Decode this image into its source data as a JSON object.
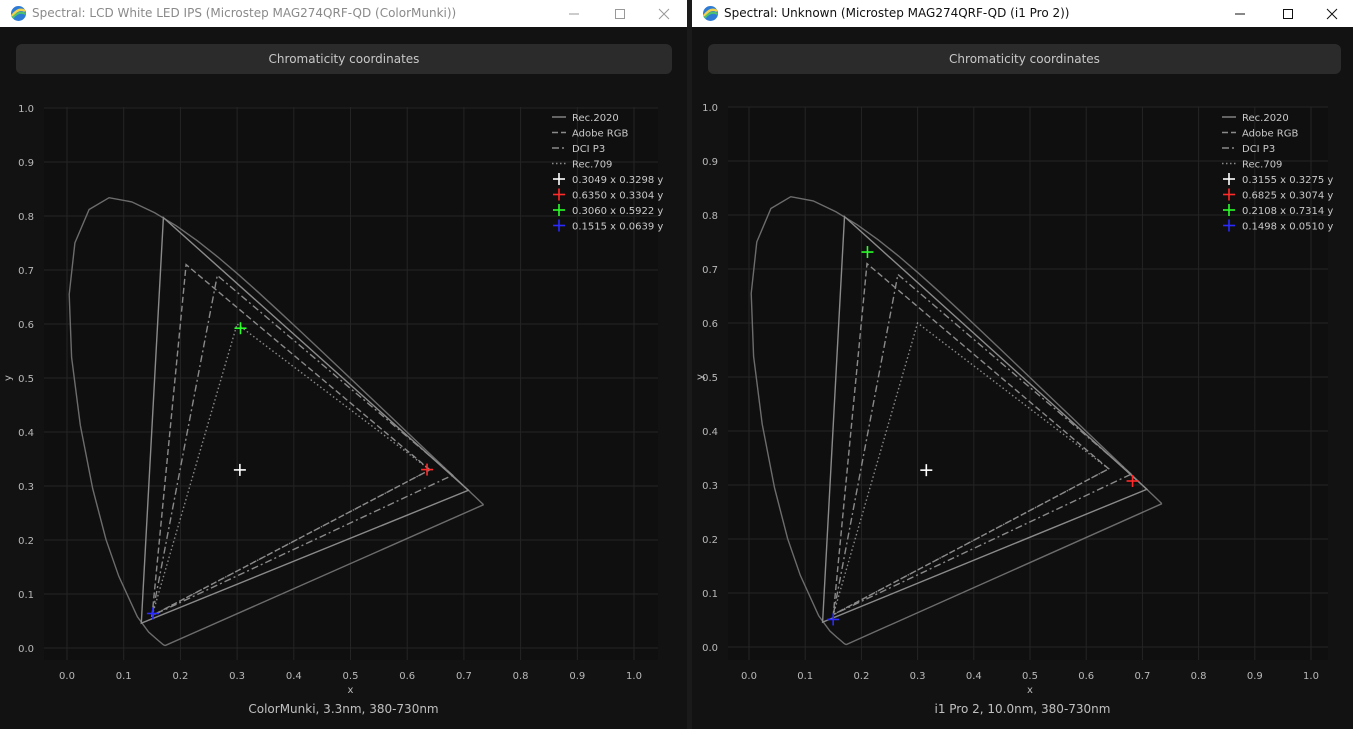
{
  "windows": [
    {
      "title": "Spectral: LCD White LED IPS (Microstep MAG274QRF-QD (ColorMunki))",
      "active": false,
      "header_button": "Chromaticity coordinates",
      "footer": "ColorMunki, 3.3nm, 380-730nm",
      "chart_data": {
        "type": "scatter",
        "xlabel": "x",
        "ylabel": "y",
        "xlim": [
          0.0,
          1.0
        ],
        "ylim": [
          0.0,
          1.0
        ],
        "x_ticks": [
          "0.0",
          "0.1",
          "0.2",
          "0.3",
          "0.4",
          "0.5",
          "0.6",
          "0.7",
          "0.8",
          "0.9",
          "1.0"
        ],
        "y_ticks": [
          "0.0",
          "0.1",
          "0.2",
          "0.3",
          "0.4",
          "0.5",
          "0.6",
          "0.7",
          "0.8",
          "0.9",
          "1.0"
        ],
        "grid": true,
        "legend_position": "top-right",
        "gamuts": [
          {
            "name": "Rec.2020",
            "style": "solid",
            "points": [
              [
                0.708,
                0.292
              ],
              [
                0.17,
                0.797
              ],
              [
                0.131,
                0.046
              ]
            ]
          },
          {
            "name": "Adobe RGB",
            "style": "dashed",
            "points": [
              [
                0.64,
                0.33
              ],
              [
                0.21,
                0.71
              ],
              [
                0.15,
                0.06
              ]
            ]
          },
          {
            "name": "DCI P3",
            "style": "dashdot",
            "points": [
              [
                0.68,
                0.32
              ],
              [
                0.265,
                0.69
              ],
              [
                0.15,
                0.06
              ]
            ]
          },
          {
            "name": "Rec.709",
            "style": "dotted",
            "points": [
              [
                0.64,
                0.33
              ],
              [
                0.3,
                0.6
              ],
              [
                0.15,
                0.06
              ]
            ]
          }
        ],
        "measurements": [
          {
            "label": "0.3049 x  0.3298 y",
            "x": 0.3049,
            "y": 0.3298,
            "color": "#ffffff"
          },
          {
            "label": "0.6350 x  0.3304 y",
            "x": 0.635,
            "y": 0.3304,
            "color": "#ff2a2a"
          },
          {
            "label": "0.3060 x  0.5922 y",
            "x": 0.306,
            "y": 0.5922,
            "color": "#2aff2a"
          },
          {
            "label": "0.1515 x  0.0639 y",
            "x": 0.1515,
            "y": 0.0639,
            "color": "#2a2aff"
          }
        ]
      }
    },
    {
      "title": "Spectral: Unknown (Microstep MAG274QRF-QD (i1 Pro 2))",
      "active": true,
      "header_button": "Chromaticity coordinates",
      "footer": "i1 Pro 2, 10.0nm, 380-730nm",
      "chart_data": {
        "type": "scatter",
        "xlabel": "x",
        "ylabel": "y",
        "xlim": [
          0.0,
          1.0
        ],
        "ylim": [
          0.0,
          1.0
        ],
        "x_ticks": [
          "0.0",
          "0.1",
          "0.2",
          "0.3",
          "0.4",
          "0.5",
          "0.6",
          "0.7",
          "0.8",
          "0.9",
          "1.0"
        ],
        "y_ticks": [
          "0.0",
          "0.1",
          "0.2",
          "0.3",
          "0.4",
          "0.5",
          "0.6",
          "0.7",
          "0.8",
          "0.9",
          "1.0"
        ],
        "grid": true,
        "legend_position": "top-right",
        "gamuts": [
          {
            "name": "Rec.2020",
            "style": "solid",
            "points": [
              [
                0.708,
                0.292
              ],
              [
                0.17,
                0.797
              ],
              [
                0.131,
                0.046
              ]
            ]
          },
          {
            "name": "Adobe RGB",
            "style": "dashed",
            "points": [
              [
                0.64,
                0.33
              ],
              [
                0.21,
                0.71
              ],
              [
                0.15,
                0.06
              ]
            ]
          },
          {
            "name": "DCI P3",
            "style": "dashdot",
            "points": [
              [
                0.68,
                0.32
              ],
              [
                0.265,
                0.69
              ],
              [
                0.15,
                0.06
              ]
            ]
          },
          {
            "name": "Rec.709",
            "style": "dotted",
            "points": [
              [
                0.64,
                0.33
              ],
              [
                0.3,
                0.6
              ],
              [
                0.15,
                0.06
              ]
            ]
          }
        ],
        "measurements": [
          {
            "label": "0.3155 x  0.3275 y",
            "x": 0.3155,
            "y": 0.3275,
            "color": "#ffffff"
          },
          {
            "label": "0.6825 x  0.3074 y",
            "x": 0.6825,
            "y": 0.3074,
            "color": "#ff2a2a"
          },
          {
            "label": "0.2108 x  0.7314 y",
            "x": 0.2108,
            "y": 0.7314,
            "color": "#2aff2a"
          },
          {
            "label": "0.1498 x  0.0510 y",
            "x": 0.1498,
            "y": 0.051,
            "color": "#2a2aff"
          }
        ]
      }
    }
  ],
  "spectral_locus": [
    [
      0.1741,
      0.005
    ],
    [
      0.1738,
      0.0049
    ],
    [
      0.1733,
      0.0048
    ],
    [
      0.1726,
      0.0048
    ],
    [
      0.1714,
      0.0051
    ],
    [
      0.1689,
      0.0069
    ],
    [
      0.1644,
      0.0109
    ],
    [
      0.1566,
      0.0177
    ],
    [
      0.144,
      0.0297
    ],
    [
      0.1241,
      0.0578
    ],
    [
      0.0913,
      0.1327
    ],
    [
      0.0687,
      0.2007
    ],
    [
      0.0454,
      0.295
    ],
    [
      0.0235,
      0.4127
    ],
    [
      0.0082,
      0.5384
    ],
    [
      0.0039,
      0.6548
    ],
    [
      0.0139,
      0.7502
    ],
    [
      0.0389,
      0.812
    ],
    [
      0.0743,
      0.8338
    ],
    [
      0.1142,
      0.8262
    ],
    [
      0.1547,
      0.8059
    ],
    [
      0.1929,
      0.7816
    ],
    [
      0.2296,
      0.7543
    ],
    [
      0.2658,
      0.7243
    ],
    [
      0.3016,
      0.6923
    ],
    [
      0.3373,
      0.6589
    ],
    [
      0.3731,
      0.6245
    ],
    [
      0.4087,
      0.5896
    ],
    [
      0.4441,
      0.5547
    ],
    [
      0.4788,
      0.5202
    ],
    [
      0.5125,
      0.4866
    ],
    [
      0.5448,
      0.4544
    ],
    [
      0.5752,
      0.4242
    ],
    [
      0.6029,
      0.3965
    ],
    [
      0.627,
      0.3725
    ],
    [
      0.6482,
      0.3514
    ],
    [
      0.6658,
      0.334
    ],
    [
      0.6801,
      0.3197
    ],
    [
      0.6915,
      0.3083
    ],
    [
      0.7006,
      0.2993
    ],
    [
      0.7079,
      0.292
    ],
    [
      0.714,
      0.2859
    ],
    [
      0.719,
      0.2809
    ],
    [
      0.723,
      0.277
    ],
    [
      0.726,
      0.274
    ],
    [
      0.7283,
      0.2717
    ],
    [
      0.73,
      0.27
    ],
    [
      0.7311,
      0.2689
    ],
    [
      0.732,
      0.268
    ],
    [
      0.7327,
      0.2673
    ],
    [
      0.7334,
      0.2666
    ],
    [
      0.734,
      0.266
    ],
    [
      0.7344,
      0.2656
    ],
    [
      0.7346,
      0.2654
    ],
    [
      0.7347,
      0.2653
    ]
  ]
}
